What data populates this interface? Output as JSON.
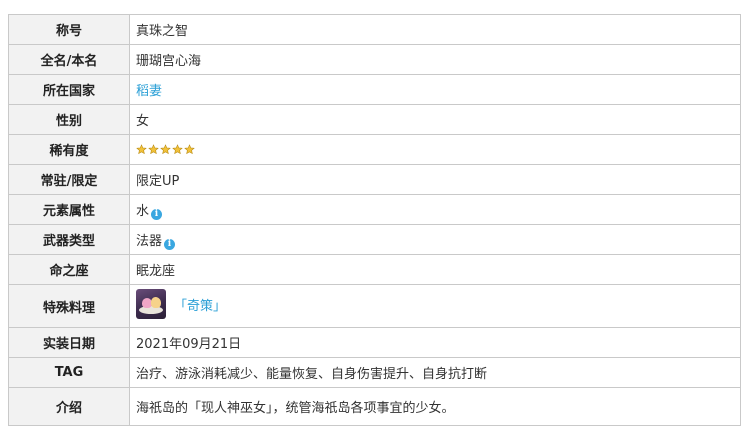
{
  "rows": {
    "title": {
      "label": "称号",
      "value": "真珠之智"
    },
    "full_name": {
      "label": "全名/本名",
      "value": "珊瑚宫心海"
    },
    "nation": {
      "label": "所在国家",
      "value": "稻妻"
    },
    "gender": {
      "label": "性别",
      "value": "女"
    },
    "rarity": {
      "label": "稀有度",
      "stars": 5,
      "star_color": "#f2c23a"
    },
    "banner": {
      "label": "常驻/限定",
      "value": "限定UP"
    },
    "element": {
      "label": "元素属性",
      "value": "水",
      "icon": "info-icon"
    },
    "weapon": {
      "label": "武器类型",
      "value": "法器",
      "icon": "info-icon"
    },
    "constellation": {
      "label": "命之座",
      "value": "眠龙座"
    },
    "special_dish": {
      "label": "特殊料理",
      "value": "「奇策」",
      "icon": "dish-image"
    },
    "release_date": {
      "label": "实装日期",
      "value": "2021年09月21日"
    },
    "tag": {
      "label": "TAG",
      "value": "治疗、游泳消耗减少、能量恢复、自身伤害提升、自身抗打断"
    },
    "intro": {
      "label": "介绍",
      "value": "海祇岛的「现人神巫女」，统管海祇岛各项事宜的少女。"
    }
  },
  "colors": {
    "label_bg": "#f2f2f2",
    "border": "#c9c9c9",
    "link": "#2a9fd6",
    "info_icon": "#3aa7e0"
  }
}
